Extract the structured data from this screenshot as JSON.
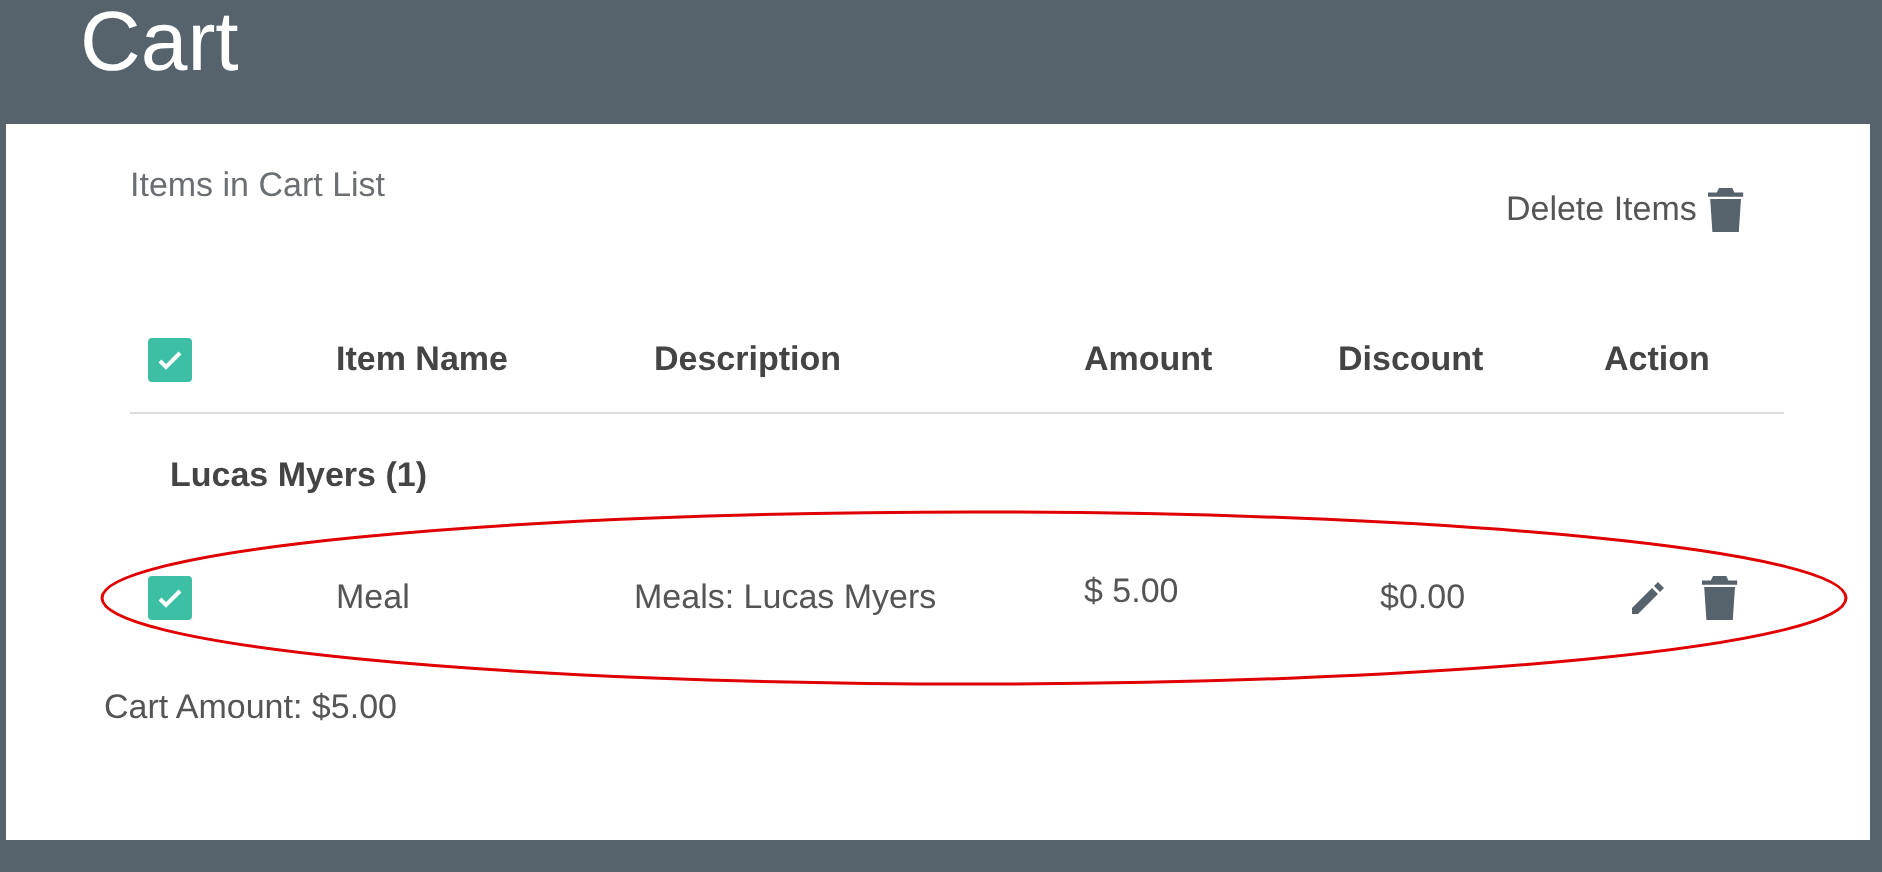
{
  "page_title": "Cart",
  "list_title": "Items in Cart List",
  "delete_button": "Delete Items",
  "table": {
    "all_checked": true,
    "columns": [
      "Item Name",
      "Description",
      "Amount",
      "Discount",
      "Action"
    ],
    "groups": [
      {
        "name": "Lucas Myers (1)",
        "rows": [
          {
            "checked": true,
            "item_name": "Meal",
            "description": "Meals: Lucas Myers",
            "amount": "$ 5.00",
            "discount": "$0.00",
            "highlighted": true
          }
        ]
      }
    ]
  },
  "cart_amount": "Cart Amount: $5.00"
}
